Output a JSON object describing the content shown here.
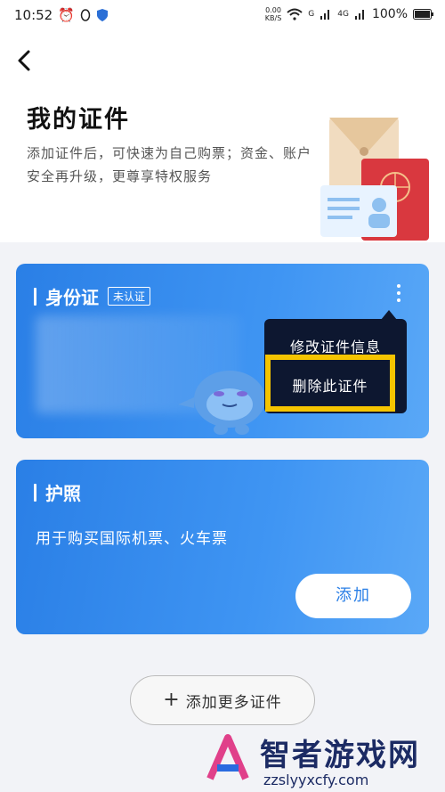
{
  "status_bar": {
    "time": "10:52",
    "speed_value": "0.00",
    "speed_unit": "KB/S",
    "sig1": "G",
    "sig2": "4G",
    "battery": "100%"
  },
  "header": {
    "title": "我的证件",
    "subtitle": "添加证件后，可快速为自己购票；资金、账户安全再升级，更尊享特权服务"
  },
  "id_card": {
    "title": "身份证",
    "badge": "未认证"
  },
  "context_menu": {
    "items": [
      "修改证件信息",
      "删除此证件"
    ]
  },
  "passport_card": {
    "title": "护照",
    "description": "用于购买国际机票、火车票",
    "add_label": "添加"
  },
  "add_more_label": "添加更多证件",
  "watermark": {
    "text": "智者游戏网",
    "url": "zzslyyxcfy.com"
  },
  "colors": {
    "accent": "#2a7fe6",
    "highlight": "#f5c400",
    "menu_bg": "#0d1730"
  }
}
